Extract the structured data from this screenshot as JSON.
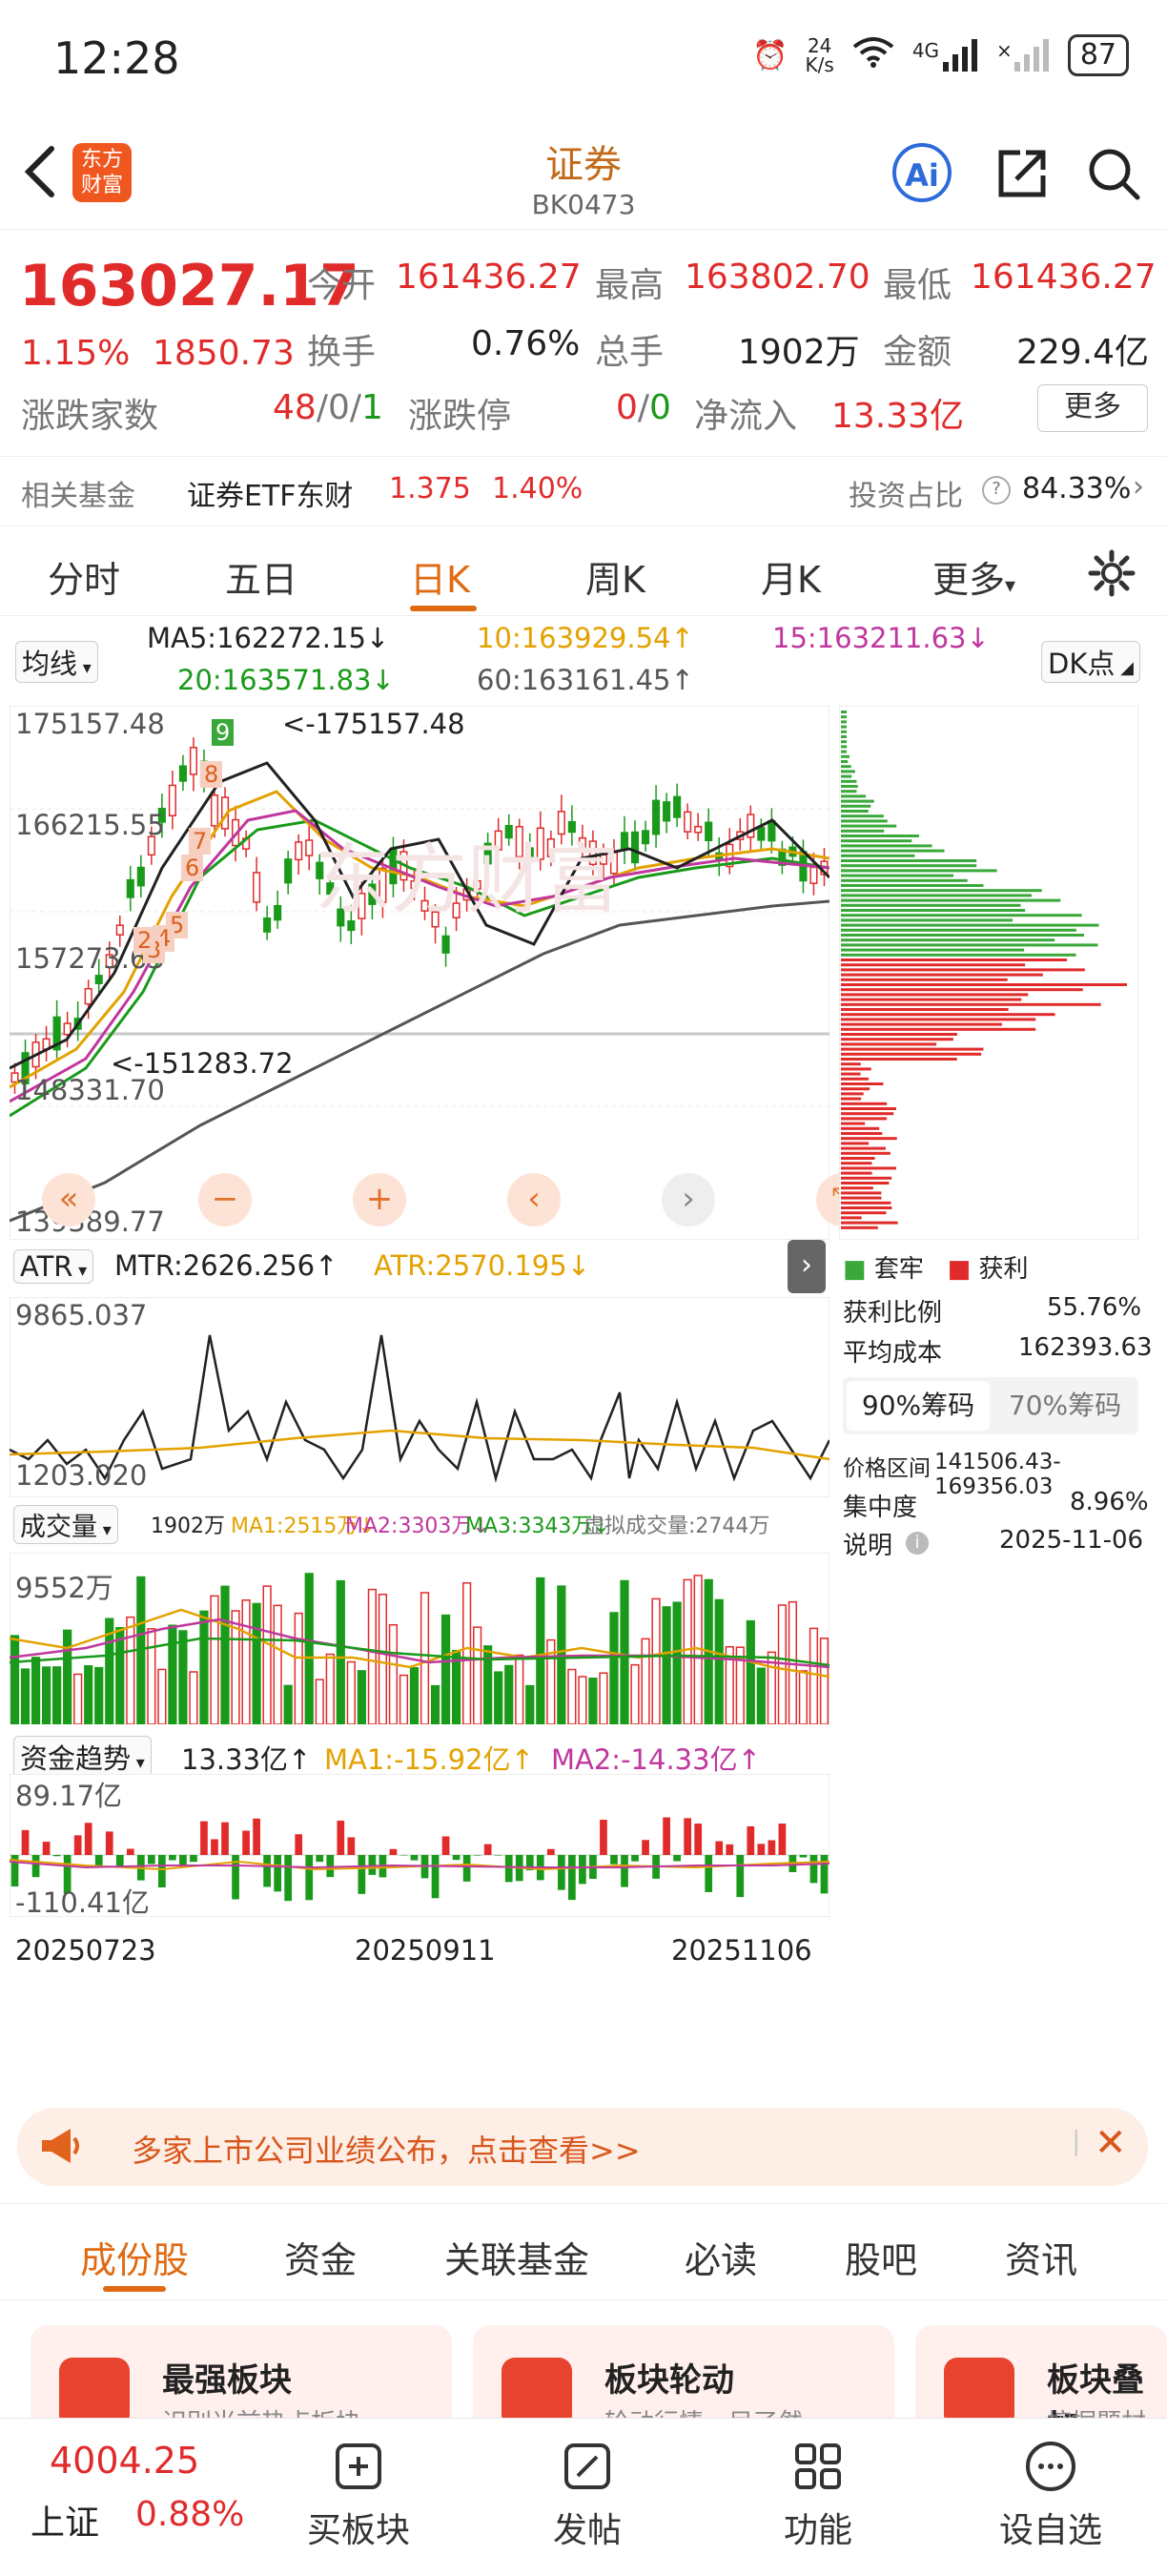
{
  "status_bar": {
    "time": "12:28",
    "net_speed_top": "24",
    "net_speed_bottom": "K/s",
    "battery": "87",
    "signal_1": "4G",
    "signal_2": "×"
  },
  "header": {
    "title": "证券",
    "code": "BK0473",
    "logo_top": "东方",
    "logo_bottom": "财富",
    "ai_label": "Ai"
  },
  "quote": {
    "price": "163027.17",
    "change_pct": "1.15%",
    "change_abs": "1850.73",
    "open_label": "今开",
    "open": "161436.27",
    "high_label": "最高",
    "high": "163802.70",
    "low_label": "最低",
    "low": "161436.27",
    "turnover_label": "换手",
    "turnover": "0.76%",
    "volume_label": "总手",
    "volume": "1902万",
    "amount_label": "金额",
    "amount": "229.4亿",
    "updown_label": "涨跌家数",
    "up": "48",
    "sep1": "/",
    "flat": "0",
    "sep2": "/",
    "down": "1",
    "limit_label": "涨跌停",
    "limit_up": "0",
    "limit_sep": "/",
    "limit_down": "0",
    "inflow_label": "净流入",
    "inflow": "13.33亿",
    "more_button": "更多"
  },
  "fund_row": {
    "label": "相关基金",
    "fund_name": "证券ETF东财",
    "fund_price": "1.375",
    "fund_pct": "1.40%",
    "ratio_label": "投资占比",
    "ratio": "84.33%"
  },
  "tabs": {
    "items": [
      "分时",
      "五日",
      "日K",
      "周K",
      "月K",
      "更多"
    ],
    "active": "日K"
  },
  "chart": {
    "ma_select": "均线",
    "ma5": "MA5:162272.15↓",
    "ma10": "10:163929.54↑",
    "ma15": "15:163211.63↓",
    "ma20": "20:163571.83↓",
    "ma60": "60:163161.45↑",
    "dk_button": "DK点",
    "y_labels": [
      "175157.48",
      "166215.55",
      "157273.63",
      "148331.70",
      "139389.77"
    ],
    "high_annot": "<-175157.48",
    "low_annot": "<-151283.72",
    "watermark": "东方财富",
    "atr_select": "ATR",
    "mtr": "MTR:2626.256↑",
    "atr": "ATR:2570.195↓",
    "atr_y": [
      "9865.037",
      "1203.020"
    ],
    "vol_select": "成交量",
    "vol_now": "1902万",
    "vol_ma1": "MA1:2515万↓",
    "vol_ma2": "MA2:3303万↓",
    "vol_ma3": "MA3:3343万↓",
    "vol_virtual": "虚拟成交量:2744万",
    "vol_y": "9552万",
    "fund_select": "资金趋势",
    "fund_now": "13.33亿↑",
    "fund_ma1": "MA1:-15.92亿↑",
    "fund_ma2": "MA2:-14.33亿↑",
    "fund_y": [
      "89.17亿",
      "-110.41亿"
    ],
    "dates": [
      "20250723",
      "20250911",
      "20251106"
    ],
    "tdx_numbers": [
      "2",
      "3",
      "4",
      "5",
      "6",
      "7",
      "8",
      "9"
    ]
  },
  "chips": {
    "legend_firm": "套牢",
    "legend_profit": "获利",
    "profit_ratio_label": "获利比例",
    "profit_ratio": "55.76%",
    "avg_cost_label": "平均成本",
    "avg_cost": "162393.63",
    "tab90": "90%筹码",
    "tab70": "70%筹码",
    "range_label": "价格区间",
    "range": "141506.43-169356.03",
    "concentration_label": "集中度",
    "concentration": "8.96%",
    "note_label": "说明",
    "note_date": "2025-11-06"
  },
  "banner": {
    "text": "多家上市公司业绩公布，点击查看>>"
  },
  "lower_tabs": {
    "items": [
      "成份股",
      "资金",
      "关联基金",
      "必读",
      "股吧",
      "资讯"
    ],
    "active": "成份股"
  },
  "cards": [
    {
      "title": "最强板块",
      "subtitle": "识别当前热点板块"
    },
    {
      "title": "板块轮动",
      "subtitle": "轮动行情一目了然"
    },
    {
      "title": "板块叠加",
      "subtitle": "挖掘题材机会"
    }
  ],
  "bottom_nav": {
    "index_value": "4004.25",
    "index_name": "上证",
    "index_pct": "0.88%",
    "items": [
      "买板块",
      "发帖",
      "功能",
      "设自选"
    ]
  },
  "colors": {
    "up": "#e12b2b",
    "down": "#1a9a1a",
    "accent": "#e06a12"
  }
}
